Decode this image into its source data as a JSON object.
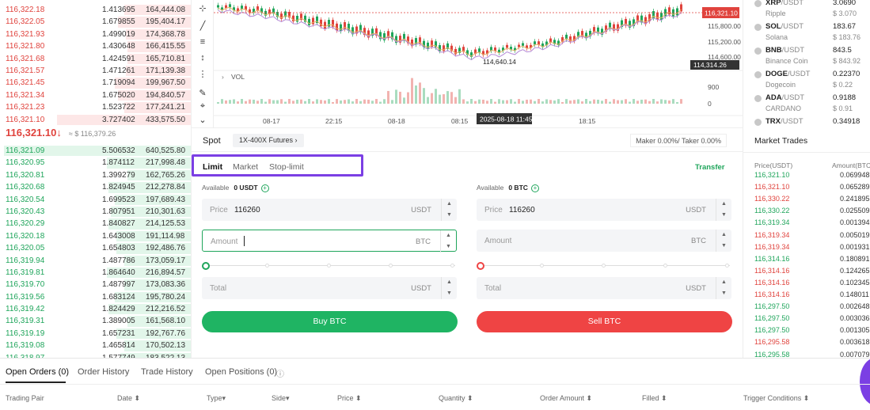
{
  "orderbook": {
    "asks": [
      {
        "price": "116,322.18",
        "amount": "1.413695",
        "total": "164,444.08",
        "depth": 0.35
      },
      {
        "price": "116,322.05",
        "amount": "1.679855",
        "total": "195,404.17",
        "depth": 0.38
      },
      {
        "price": "116,321.93",
        "amount": "1.499019",
        "total": "174,368.78",
        "depth": 0.34
      },
      {
        "price": "116,321.80",
        "amount": "1.430648",
        "total": "166,415.55",
        "depth": 0.33
      },
      {
        "price": "116,321.68",
        "amount": "1.424591",
        "total": "165,710.81",
        "depth": 0.33
      },
      {
        "price": "116,321.57",
        "amount": "1.471261",
        "total": "171,139.38",
        "depth": 0.34
      },
      {
        "price": "116,321.45",
        "amount": "1.719094",
        "total": "199,967.50",
        "depth": 0.4
      },
      {
        "price": "116,321.34",
        "amount": "1.675020",
        "total": "194,840.57",
        "depth": 0.38
      },
      {
        "price": "116,321.23",
        "amount": "1.523722",
        "total": "177,241.21",
        "depth": 0.35
      },
      {
        "price": "116,321.10",
        "amount": "3.727402",
        "total": "433,575.50",
        "depth": 0.7
      }
    ],
    "last_price": "116,321.10↓",
    "last_price_usd": "≈ $ 116,379.26",
    "bids": [
      {
        "price": "116,321.09",
        "amount": "5.506532",
        "total": "640,525.80",
        "depth": 0.98
      },
      {
        "price": "116,320.95",
        "amount": "1.874112",
        "total": "217,998.48",
        "depth": 0.44
      },
      {
        "price": "116,320.81",
        "amount": "1.399279",
        "total": "162,765.26",
        "depth": 0.33
      },
      {
        "price": "116,320.68",
        "amount": "1.824945",
        "total": "212,278.84",
        "depth": 0.43
      },
      {
        "price": "116,320.54",
        "amount": "1.699523",
        "total": "197,689.43",
        "depth": 0.4
      },
      {
        "price": "116,320.43",
        "amount": "1.807951",
        "total": "210,301.63",
        "depth": 0.42
      },
      {
        "price": "116,320.29",
        "amount": "1.840827",
        "total": "214,125.53",
        "depth": 0.43
      },
      {
        "price": "116,320.18",
        "amount": "1.643008",
        "total": "191,114.98",
        "depth": 0.39
      },
      {
        "price": "116,320.05",
        "amount": "1.654803",
        "total": "192,486.76",
        "depth": 0.39
      },
      {
        "price": "116,319.94",
        "amount": "1.487786",
        "total": "173,059.17",
        "depth": 0.35
      },
      {
        "price": "116,319.81",
        "amount": "1.864640",
        "total": "216,894.57",
        "depth": 0.44
      },
      {
        "price": "116,319.70",
        "amount": "1.487997",
        "total": "173,083.36",
        "depth": 0.35
      },
      {
        "price": "116,319.56",
        "amount": "1.683124",
        "total": "195,780.24",
        "depth": 0.4
      },
      {
        "price": "116,319.42",
        "amount": "1.824429",
        "total": "212,216.52",
        "depth": 0.43
      },
      {
        "price": "116,319.31",
        "amount": "1.389005",
        "total": "161,568.10",
        "depth": 0.33
      },
      {
        "price": "116,319.19",
        "amount": "1.657231",
        "total": "192,767.76",
        "depth": 0.39
      },
      {
        "price": "116,319.08",
        "amount": "1.465814",
        "total": "170,502.13",
        "depth": 0.35
      },
      {
        "price": "116,318.97",
        "amount": "1.577749",
        "total": "183,522.13",
        "depth": 0.37
      }
    ]
  },
  "chart": {
    "current_price_tag": "116,321.10",
    "y_labels": [
      "115,800.00",
      "115,200.00",
      "114,600.00"
    ],
    "low_label": "114,640.14",
    "price_hover_tag": "114,314.26",
    "vol_label": "VOL",
    "vol_y": [
      "900",
      "0"
    ],
    "x_labels": [
      "08-17",
      "22:15",
      "08-18",
      "08:15",
      "2025-08-18 11:45",
      "18:15"
    ],
    "colors": {
      "up": "#1fa55b",
      "down": "#e0433d",
      "ma1": "#e7b36a",
      "ma2": "#b48ad6"
    }
  },
  "trade": {
    "spot": "Spot",
    "futures": "1X-400X Futures ›",
    "fees": "Maker 0.00%/ Taker 0.00%",
    "order_types": {
      "limit": "Limit",
      "market": "Market",
      "stop": "Stop-limit"
    },
    "transfer": "Transfer",
    "buy": {
      "available_label": "Available",
      "available": "0 USDT",
      "price_label": "Price",
      "price": "116260",
      "price_unit": "USDT",
      "amount_label": "Amount",
      "amount_unit": "BTC",
      "total_label": "Total",
      "total_unit": "USDT",
      "button": "Buy BTC"
    },
    "sell": {
      "available_label": "Available",
      "available": "0 BTC",
      "price_label": "Price",
      "price": "116260",
      "price_unit": "USDT",
      "amount_label": "Amount",
      "amount_unit": "BTC",
      "total_label": "Total",
      "total_unit": "USDT",
      "button": "Sell BTC"
    }
  },
  "tickers": [
    {
      "base": "XRP",
      "quote": "/USDT",
      "name": "Ripple",
      "price": "3.0690",
      "usd": "$ 3.070"
    },
    {
      "base": "SOL",
      "quote": "/USDT",
      "name": "Solana",
      "price": "183.67",
      "usd": "$ 183.76"
    },
    {
      "base": "BNB",
      "quote": "/USDT",
      "name": "Binance Coin",
      "price": "843.5",
      "usd": "$ 843.92"
    },
    {
      "base": "DOGE",
      "quote": "/USDT",
      "name": "Dogecoin",
      "price": "0.22370",
      "usd": "$ 0.22"
    },
    {
      "base": "ADA",
      "quote": "/USDT",
      "name": "CARDANO",
      "price": "0.9188",
      "usd": "$ 0.91"
    },
    {
      "base": "TRX",
      "quote": "/USDT",
      "name": "",
      "price": "0.34918",
      "usd": ""
    }
  ],
  "market_trades": {
    "title": "Market Trades",
    "price_header": "Price(USDT)",
    "amount_header": "Amount(BTC",
    "rows": [
      {
        "p": "116,321.10",
        "a": "0.069948",
        "side": "g"
      },
      {
        "p": "116,321.10",
        "a": "0.065289",
        "side": "r"
      },
      {
        "p": "116,330.22",
        "a": "0.241895",
        "side": "r"
      },
      {
        "p": "116,330.22",
        "a": "0.025509",
        "side": "g"
      },
      {
        "p": "116,319.34",
        "a": "0.001394",
        "side": "g"
      },
      {
        "p": "116,319.34",
        "a": "0.005019",
        "side": "r"
      },
      {
        "p": "116,319.34",
        "a": "0.001931",
        "side": "r"
      },
      {
        "p": "116,314.16",
        "a": "0.180891",
        "side": "g"
      },
      {
        "p": "116,314.16",
        "a": "0.124265",
        "side": "r"
      },
      {
        "p": "116,314.16",
        "a": "0.102345",
        "side": "r"
      },
      {
        "p": "116,314.16",
        "a": "0.148011",
        "side": "r"
      },
      {
        "p": "116,297.50",
        "a": "0.002648",
        "side": "g"
      },
      {
        "p": "116,297.50",
        "a": "0.003036",
        "side": "g"
      },
      {
        "p": "116,297.50",
        "a": "0.001305",
        "side": "g"
      },
      {
        "p": "116,295.58",
        "a": "0.003618",
        "side": "r"
      },
      {
        "p": "116,295.58",
        "a": "0.007079",
        "side": "g"
      }
    ]
  },
  "bottom": {
    "tabs": {
      "open": "Open Orders (0)",
      "history": "Order History",
      "trades": "Trade History",
      "positions": "Open Positions (0)"
    },
    "columns": {
      "pair": "Trading Pair",
      "date": "Date ⬍",
      "type": "Type▾",
      "side": "Side▾",
      "price": "Price ⬍",
      "qty": "Quantity ⬍",
      "amount": "Order Amount ⬍",
      "filled": "Filled ⬍",
      "trigger": "Trigger Conditions ⬍"
    }
  }
}
